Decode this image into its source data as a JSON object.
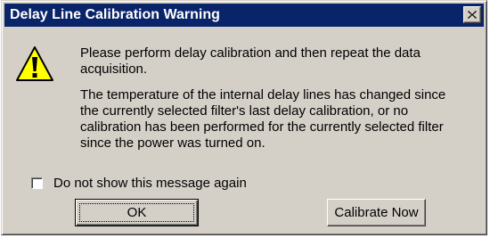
{
  "dialog": {
    "title": "Delay Line Calibration Warning",
    "close_label": "×",
    "icon": "warning-icon",
    "message_primary": "Please perform delay calibration and then repeat the data acquisition.",
    "message_detail": "The temperature of the internal delay lines has changed since the currently selected filter's last delay calibration, or no calibration has been performed for the currently selected filter since the power was turned on.",
    "checkbox_label": "Do not show this message again",
    "checkbox_checked": false,
    "ok_label": "OK",
    "calibrate_label": "Calibrate Now"
  },
  "colors": {
    "titlebar": "#0a246a",
    "face": "#d4d0c8",
    "warning_fill": "#ffff00"
  }
}
